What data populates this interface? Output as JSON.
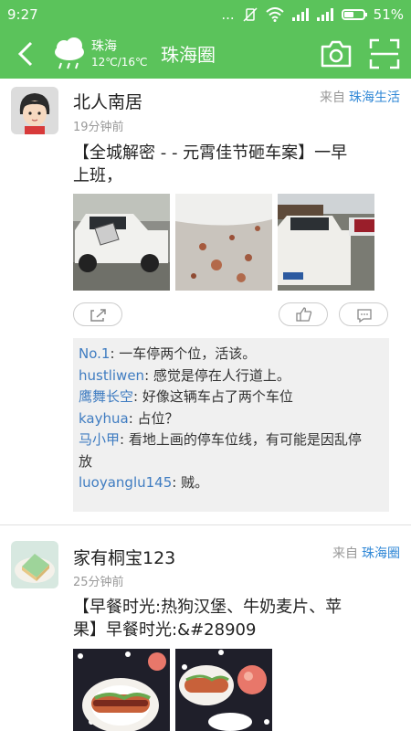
{
  "status": {
    "time": "9:27",
    "signal_dots": "...",
    "battery": "51%",
    "battery_level": 0.51
  },
  "header": {
    "title": "珠海圈",
    "weather": {
      "city": "珠海",
      "temp": "12℃/16℃"
    }
  },
  "posts": [
    {
      "author": "北人南居",
      "time": "19分钟前",
      "source_prefix": "来自",
      "source_name": "珠海生活",
      "text_line1": "【全城解密 - - 元霄佳节砸车案】一早",
      "text_line2": "上班，",
      "comments": [
        {
          "user": "No.1",
          "text": "一车停两个位，活该。"
        },
        {
          "user": "hustliwen",
          "text": "感觉是停在人行道上。"
        },
        {
          "user": "鹰舞长空",
          "text": "好像这辆车占了两个车位"
        },
        {
          "user": "kayhua",
          "text": "占位？"
        },
        {
          "user": "马小甲",
          "text": "看地上画的停车位线，有可能是因乱停",
          "text2": "放"
        },
        {
          "user": "luoyanglu145",
          "text": "贼。"
        }
      ]
    },
    {
      "author": "家有桐宝123",
      "time": "25分钟前",
      "source_prefix": "来自",
      "source_name": "珠海圈",
      "text_line1": "【早餐时光:热狗汉堡、牛奶麦片、苹",
      "text_line2": "果】早餐时光:&#28909"
    }
  ],
  "icons": [
    "back-arrow-icon",
    "cloud-weather-icon",
    "camera-icon",
    "scan-icon",
    "share-icon",
    "thumbs-up-icon",
    "comment-icon"
  ],
  "colors": {
    "header": "#5bc35b",
    "link": "#2f87d6",
    "comment_user": "#3f7cc1"
  }
}
